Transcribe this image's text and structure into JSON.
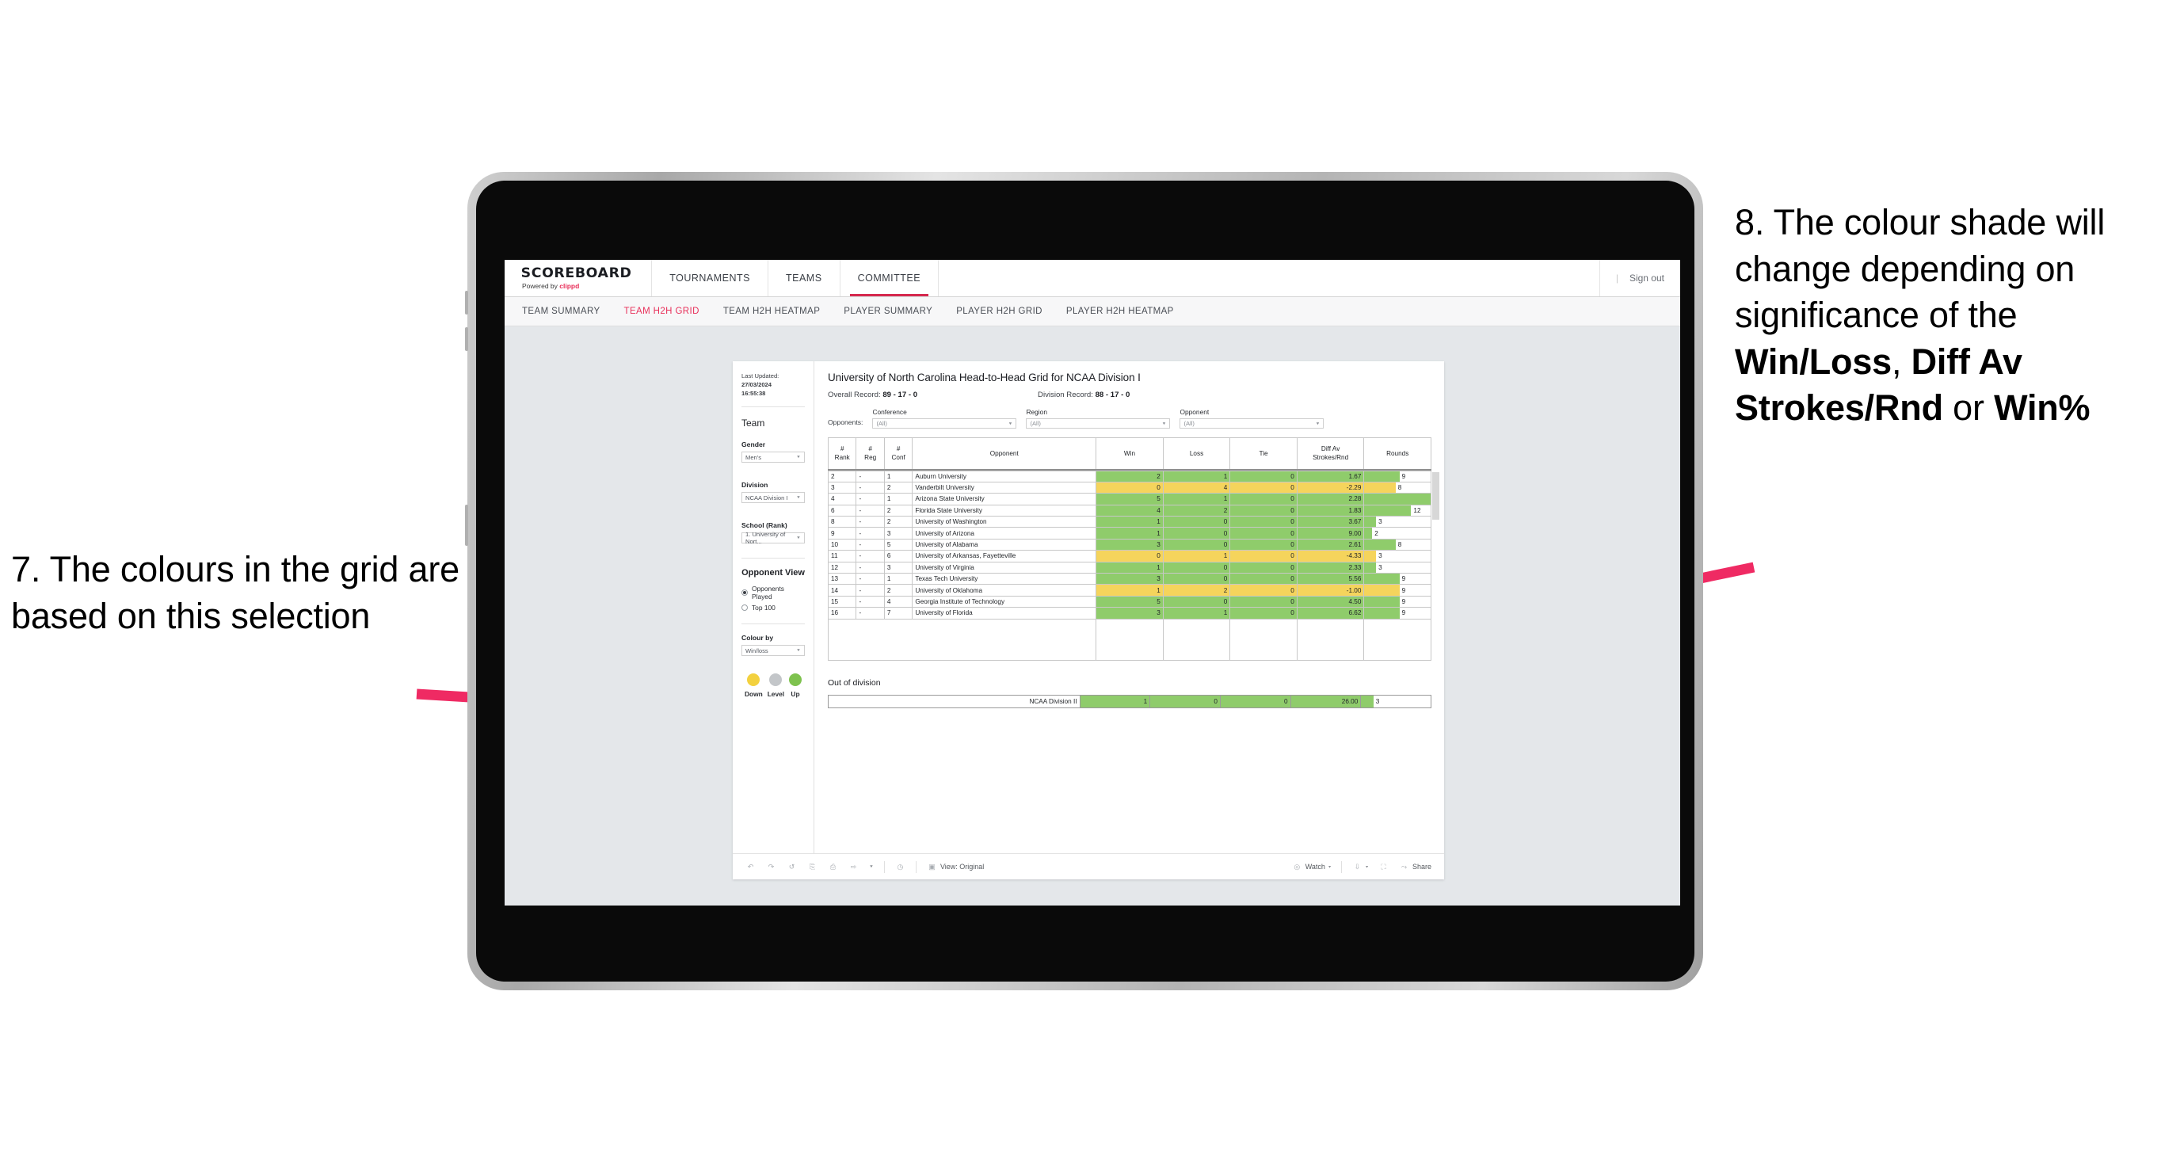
{
  "annotations": {
    "left": {
      "name": "annotation-7",
      "text": "7. The colours in the grid are based on this selection"
    },
    "right": {
      "name": "annotation-8",
      "pre": "8. The colour shade will change depending on significance of the ",
      "bold1": "Win/Loss",
      "mid1": ", ",
      "bold2": "Diff Av Strokes/Rnd",
      "mid2": " or ",
      "bold3": "Win%"
    },
    "arrow_color": "#ef2a63"
  },
  "topnav": {
    "brand_title": "SCOREBOARD",
    "brand_sub_prefix": "Powered by ",
    "brand_sub_name": "clippd",
    "items": [
      {
        "label": "TOURNAMENTS",
        "active": false
      },
      {
        "label": "TEAMS",
        "active": false
      },
      {
        "label": "COMMITTEE",
        "active": true
      }
    ],
    "divider": "|",
    "signout": "Sign out",
    "accent": "#d6294e"
  },
  "subnav": {
    "items": [
      {
        "label": "TEAM SUMMARY",
        "active": false
      },
      {
        "label": "TEAM H2H GRID",
        "active": true
      },
      {
        "label": "TEAM H2H HEATMAP",
        "active": false
      },
      {
        "label": "PLAYER SUMMARY",
        "active": false
      },
      {
        "label": "PLAYER H2H GRID",
        "active": false
      },
      {
        "label": "PLAYER H2H HEATMAP",
        "active": false
      }
    ],
    "accent": "#e8305a"
  },
  "sidebar": {
    "last_updated_label": "Last Updated: ",
    "last_updated_date": "27/03/2024",
    "last_updated_time": "16:55:38",
    "team_heading": "Team",
    "gender_label": "Gender",
    "gender_value": "Men's",
    "division_label": "Division",
    "division_value": "NCAA Division I",
    "school_label": "School (Rank)",
    "school_value": "1. University of Nort...",
    "opponent_view_heading": "Opponent View",
    "radios": [
      {
        "label": "Opponents Played",
        "selected": true
      },
      {
        "label": "Top 100",
        "selected": false
      }
    ],
    "colour_by_label": "Colour by",
    "colour_by_value": "Win/loss",
    "legend": [
      {
        "label": "Down",
        "color": "#f3d13f"
      },
      {
        "label": "Level",
        "color": "#c3c6c9"
      },
      {
        "label": "Up",
        "color": "#7ec24e"
      }
    ]
  },
  "main": {
    "title": "University of North Carolina Head-to-Head Grid for NCAA Division I",
    "overall_record_label": "Overall Record: ",
    "overall_record_value": "89 - 17 - 0",
    "division_record_label": "Division Record: ",
    "division_record_value": "88 - 17 - 0",
    "opponents_label": "Opponents:",
    "filters": [
      {
        "label": "Conference",
        "value": "(All)"
      },
      {
        "label": "Region",
        "value": "(All)"
      },
      {
        "label": "Opponent",
        "value": "(All)"
      }
    ],
    "out_of_division_title": "Out of division"
  },
  "chart_data": {
    "type": "table",
    "title": "University of North Carolina Head-to-Head Grid for NCAA Division I",
    "columns": [
      "# Rank",
      "# Reg",
      "# Conf",
      "Opponent",
      "Win",
      "Loss",
      "Tie",
      "Diff Av Strokes/Rnd",
      "Rounds"
    ],
    "header_lines": {
      "rank": [
        "#",
        "Rank"
      ],
      "reg": [
        "#",
        "Reg"
      ],
      "conf": [
        "#",
        "Conf"
      ],
      "opponent": "Opponent",
      "win": "Win",
      "loss": "Loss",
      "tie": "Tie",
      "diff": [
        "Diff Av",
        "Strokes/Rnd"
      ],
      "rounds": "Rounds"
    },
    "colors": {
      "up": "#8fcc6b",
      "down": "#f5d45c",
      "level": "#c3c6c9"
    },
    "rounds_max": 17,
    "rows": [
      {
        "rank": "2",
        "reg": "-",
        "conf": "1",
        "opponent": "Auburn University",
        "win": "2",
        "loss": "1",
        "tie": "0",
        "diff": "1.67",
        "rounds": "9",
        "shade": "up"
      },
      {
        "rank": "3",
        "reg": "-",
        "conf": "2",
        "opponent": "Vanderbilt University",
        "win": "0",
        "loss": "4",
        "tie": "0",
        "diff": "-2.29",
        "rounds": "8",
        "shade": "down"
      },
      {
        "rank": "4",
        "reg": "-",
        "conf": "1",
        "opponent": "Arizona State University",
        "win": "5",
        "loss": "1",
        "tie": "0",
        "diff": "2.28",
        "rounds": "17",
        "shade": "up"
      },
      {
        "rank": "6",
        "reg": "-",
        "conf": "2",
        "opponent": "Florida State University",
        "win": "4",
        "loss": "2",
        "tie": "0",
        "diff": "1.83",
        "rounds": "12",
        "shade": "up"
      },
      {
        "rank": "8",
        "reg": "-",
        "conf": "2",
        "opponent": "University of Washington",
        "win": "1",
        "loss": "0",
        "tie": "0",
        "diff": "3.67",
        "rounds": "3",
        "shade": "up"
      },
      {
        "rank": "9",
        "reg": "-",
        "conf": "3",
        "opponent": "University of Arizona",
        "win": "1",
        "loss": "0",
        "tie": "0",
        "diff": "9.00",
        "rounds": "2",
        "shade": "up"
      },
      {
        "rank": "10",
        "reg": "-",
        "conf": "5",
        "opponent": "University of Alabama",
        "win": "3",
        "loss": "0",
        "tie": "0",
        "diff": "2.61",
        "rounds": "8",
        "shade": "up"
      },
      {
        "rank": "11",
        "reg": "-",
        "conf": "6",
        "opponent": "University of Arkansas, Fayetteville",
        "win": "0",
        "loss": "1",
        "tie": "0",
        "diff": "-4.33",
        "rounds": "3",
        "shade": "down"
      },
      {
        "rank": "12",
        "reg": "-",
        "conf": "3",
        "opponent": "University of Virginia",
        "win": "1",
        "loss": "0",
        "tie": "0",
        "diff": "2.33",
        "rounds": "3",
        "shade": "up"
      },
      {
        "rank": "13",
        "reg": "-",
        "conf": "1",
        "opponent": "Texas Tech University",
        "win": "3",
        "loss": "0",
        "tie": "0",
        "diff": "5.56",
        "rounds": "9",
        "shade": "up"
      },
      {
        "rank": "14",
        "reg": "-",
        "conf": "2",
        "opponent": "University of Oklahoma",
        "win": "1",
        "loss": "2",
        "tie": "0",
        "diff": "-1.00",
        "rounds": "9",
        "shade": "down"
      },
      {
        "rank": "15",
        "reg": "-",
        "conf": "4",
        "opponent": "Georgia Institute of Technology",
        "win": "5",
        "loss": "0",
        "tie": "0",
        "diff": "4.50",
        "rounds": "9",
        "shade": "up"
      },
      {
        "rank": "16",
        "reg": "-",
        "conf": "7",
        "opponent": "University of Florida",
        "win": "3",
        "loss": "1",
        "tie": "0",
        "diff": "6.62",
        "rounds": "9",
        "shade": "up"
      }
    ],
    "out_of_division": {
      "label": "NCAA Division II",
      "win": "1",
      "loss": "0",
      "tie": "0",
      "diff": "26.00",
      "rounds": "3",
      "shade": "up"
    }
  },
  "toolbar": {
    "view_label": "View: Original",
    "watch_label": "Watch",
    "share_label": "Share",
    "caret": "▾"
  }
}
